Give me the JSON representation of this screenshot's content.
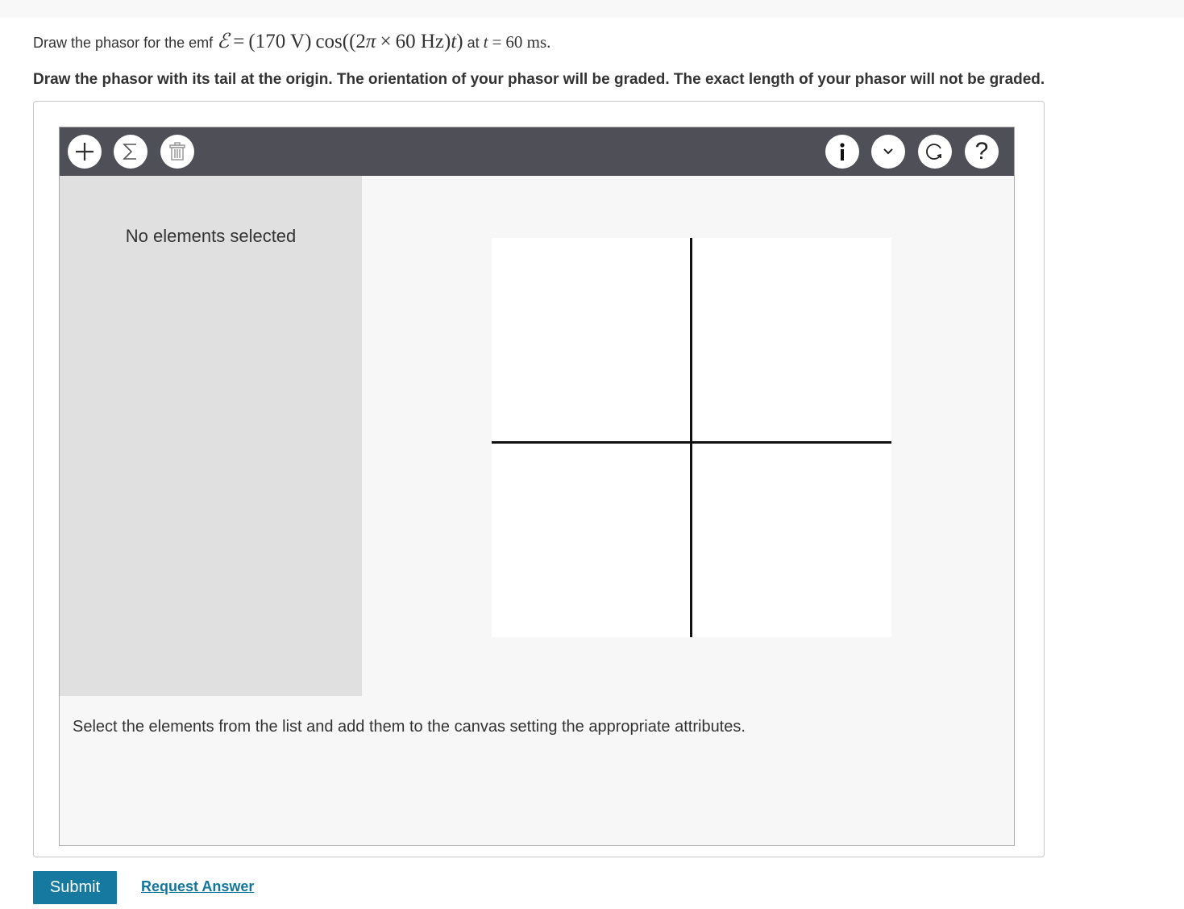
{
  "question": {
    "prefix": "Draw the phasor for the emf",
    "emf_symbol": "ℰ",
    "equals": "=",
    "amplitude": "(170 V)",
    "cos": "cos",
    "arg_open": "((2",
    "pi": "π",
    "times": "×",
    "freq": "60 Hz)",
    "t_var": "t",
    "arg_close": ")",
    "at_text": "at",
    "t_var2": "t",
    "equals2": "=",
    "time_value": "60 ms."
  },
  "instruction": "Draw the phasor with its tail at the origin. The orientation of your phasor will be graded. The exact length of your phasor will not be graded.",
  "toolbar": {
    "left_icons": [
      "add-icon",
      "sigma-icon",
      "trash-icon"
    ],
    "right_icons": [
      "info-icon",
      "chevron-down-icon",
      "reset-icon",
      "help-icon"
    ],
    "help_label": "?"
  },
  "side_panel": {
    "status": "No elements selected"
  },
  "hint": "Select the elements from the list and add them to the canvas setting the appropriate attributes.",
  "actions": {
    "submit_label": "Submit",
    "request_label": "Request Answer"
  },
  "colors": {
    "toolbar_bg": "#4f5057",
    "submit_bg": "#1579a0",
    "link": "#12759c",
    "panel_bg": "#e0e0e0"
  }
}
